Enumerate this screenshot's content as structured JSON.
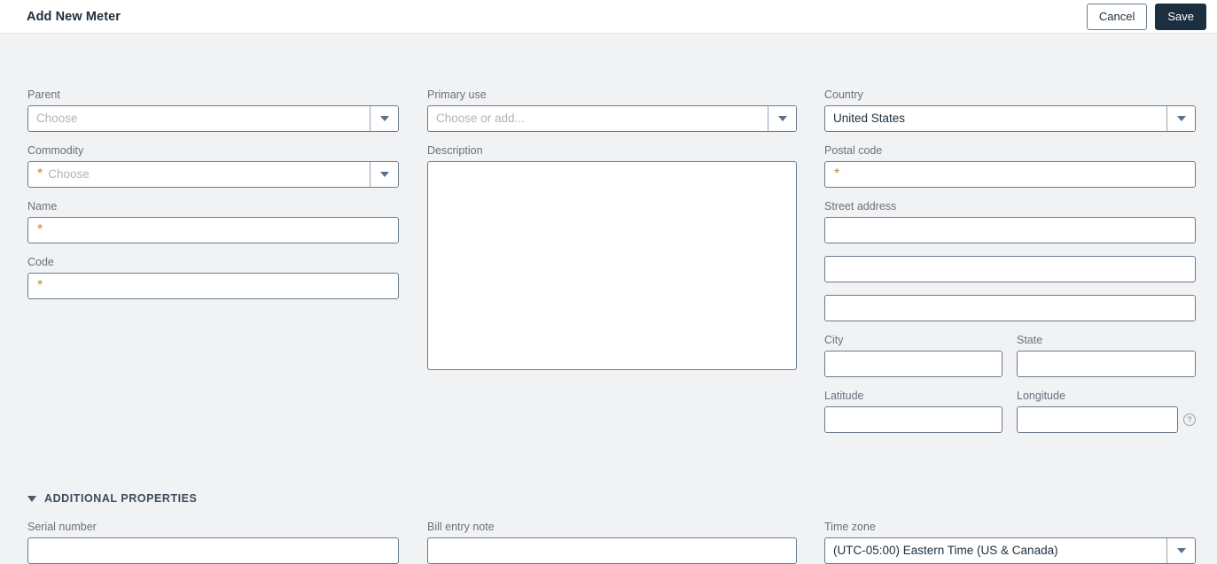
{
  "header": {
    "title": "Add New Meter",
    "cancel_label": "Cancel",
    "save_label": "Save"
  },
  "colors": {
    "accent_save_bg": "#1b2f40",
    "required_star": "#b98b2e",
    "page_bg": "#f1f2f4",
    "field_border": "#6b7b8c",
    "label_text": "#69717c"
  },
  "icons": {
    "required_star": "*",
    "dropdown_caret": "chevron-down-icon",
    "help": "?",
    "collapse_chevron": "chevron-down-icon"
  },
  "left_column": {
    "parent": {
      "label": "Parent",
      "value": "",
      "placeholder": "Choose",
      "required": false
    },
    "commodity": {
      "label": "Commodity",
      "value": "",
      "placeholder": "Choose",
      "required": true
    },
    "name": {
      "label": "Name",
      "value": "",
      "placeholder": "",
      "required": true
    },
    "code": {
      "label": "Code",
      "value": "",
      "placeholder": "",
      "required": true
    }
  },
  "middle_column": {
    "primary_use": {
      "label": "Primary use",
      "value": "",
      "placeholder": "Choose or add...",
      "required": false
    },
    "description": {
      "label": "Description",
      "value": "",
      "placeholder": ""
    }
  },
  "right_column": {
    "country": {
      "label": "Country",
      "value": "United States",
      "placeholder": "",
      "required": false
    },
    "postal_code": {
      "label": "Postal code",
      "value": "",
      "placeholder": "",
      "required": true
    },
    "street_address": {
      "label": "Street address",
      "line1": "",
      "line2": "",
      "line3": ""
    },
    "city": {
      "label": "City",
      "value": ""
    },
    "state": {
      "label": "State",
      "value": ""
    },
    "latitude": {
      "label": "Latitude",
      "value": ""
    },
    "longitude": {
      "label": "Longitude",
      "value": "",
      "help": "?"
    }
  },
  "additional_properties": {
    "section_title": "ADDITIONAL PROPERTIES",
    "serial_number": {
      "label": "Serial number",
      "value": ""
    },
    "bill_entry_note": {
      "label": "Bill entry note",
      "value": ""
    },
    "time_zone": {
      "label": "Time zone",
      "value": "(UTC-05:00) Eastern Time (US & Canada)",
      "placeholder": ""
    }
  }
}
